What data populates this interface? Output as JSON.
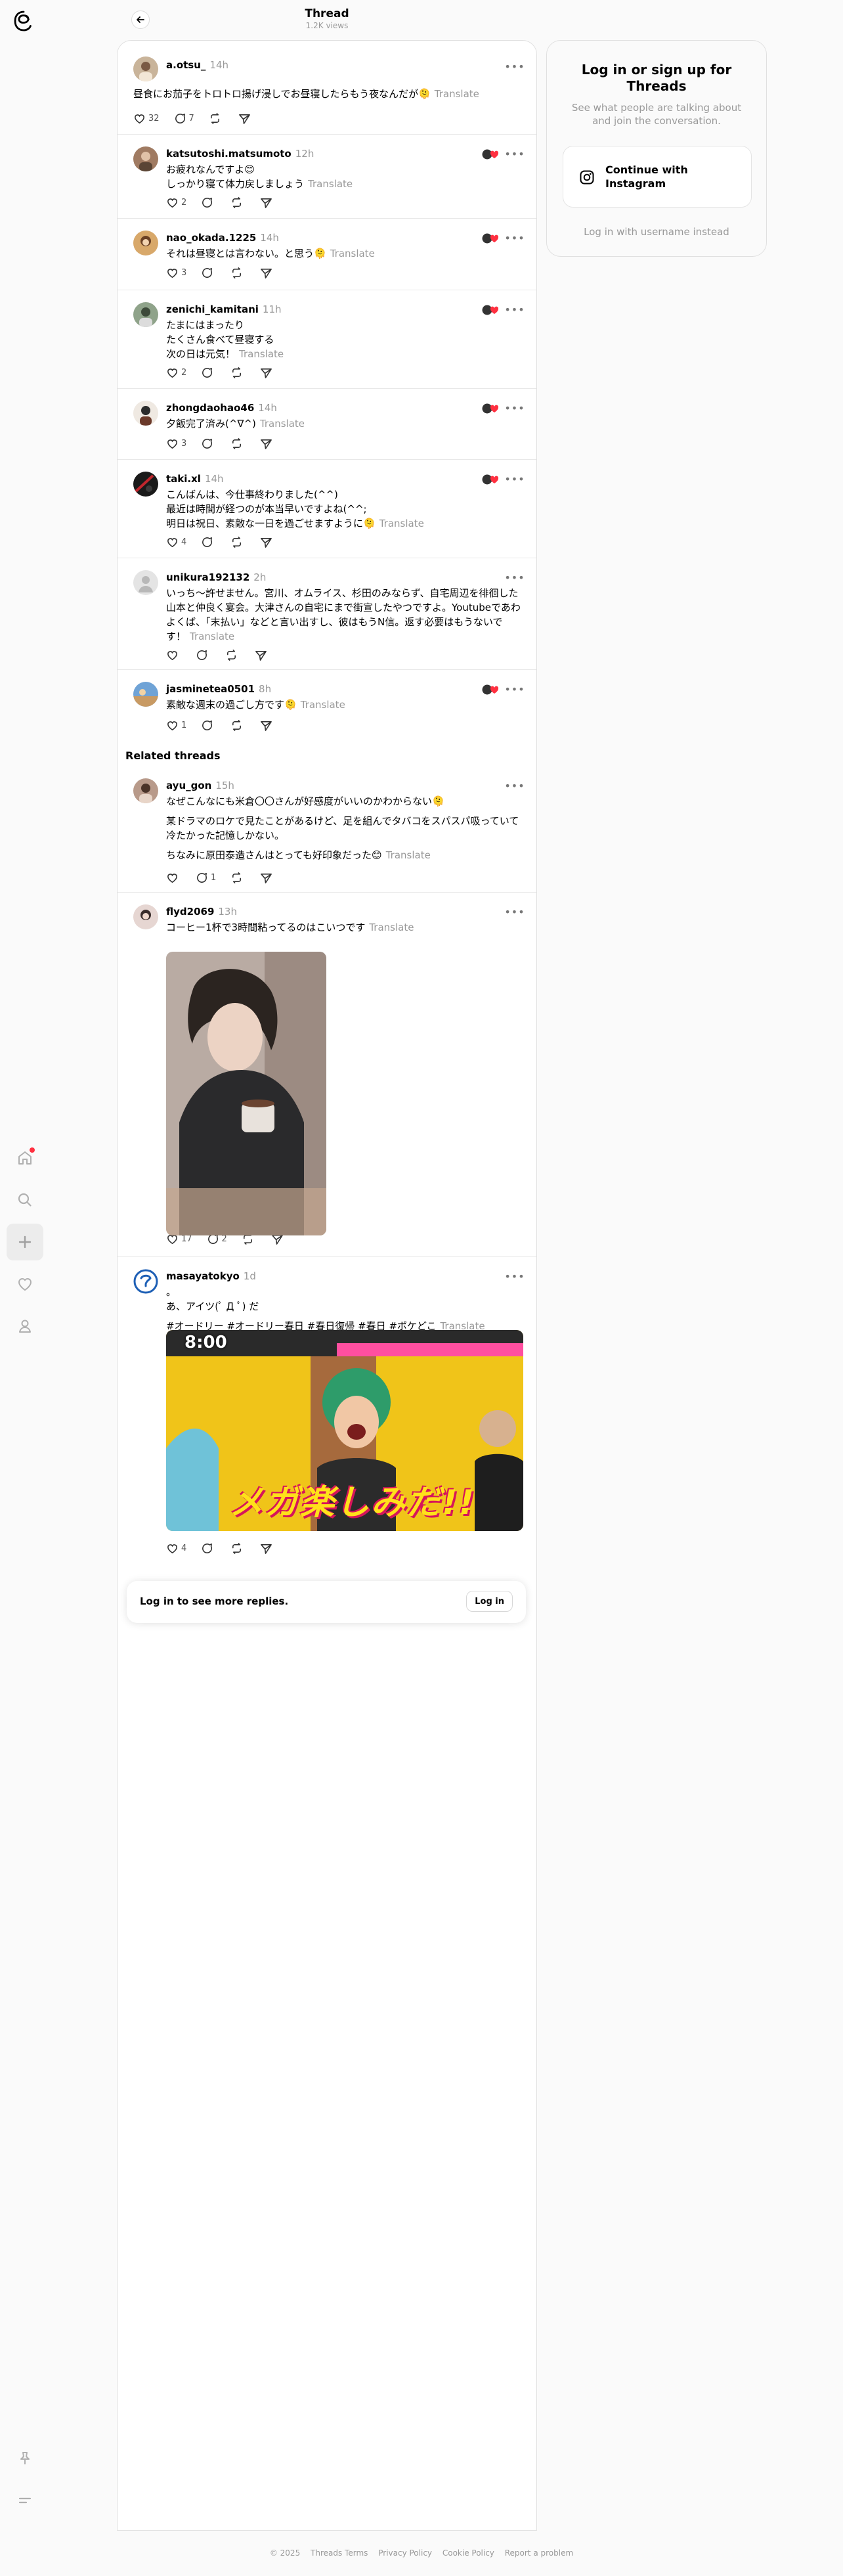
{
  "header": {
    "title": "Thread",
    "views": "1.2K views"
  },
  "posts": [
    {
      "user": "a.otsu_",
      "time": "14h",
      "lines": [
        "昼食にお茄子をトロトロ揚げ浸しでお昼寝したらもう夜なんだが🫠"
      ],
      "translate": "Translate",
      "likes": "32",
      "replies": "7",
      "reposts": "",
      "heart_badge": false
    },
    {
      "user": "katsutoshi.matsumoto",
      "time": "12h",
      "lines": [
        "お疲れなんですよ😊",
        "しっかり寝て体力戻しましょう"
      ],
      "translate": "Translate",
      "likes": "2",
      "replies": "",
      "reposts": "",
      "heart_badge": true
    },
    {
      "user": "nao_okada.1225",
      "time": "14h",
      "lines": [
        "それは昼寝とは言わない。と思う🫠"
      ],
      "translate": "Translate",
      "likes": "3",
      "replies": "",
      "reposts": "",
      "heart_badge": true
    },
    {
      "user": "zenichi_kamitani",
      "time": "11h",
      "lines": [
        "たまにはまったり",
        "たくさん食べて昼寝する",
        "次の日は元気！"
      ],
      "translate": "Translate",
      "likes": "2",
      "replies": "",
      "reposts": "",
      "heart_badge": true
    },
    {
      "user": "zhongdaohao46",
      "time": "14h",
      "lines": [
        "夕飯完了済み(^∇^)"
      ],
      "translate": "Translate",
      "likes": "3",
      "replies": "",
      "reposts": "",
      "heart_badge": true
    },
    {
      "user": "taki.xl",
      "time": "14h",
      "lines": [
        "こんばんは、今仕事終わりました(^^)",
        "最近は時間が経つのが本当早いですよね(^^;",
        "明日は祝日、素敵な一日を過ごせますように🫠"
      ],
      "translate": "Translate",
      "likes": "4",
      "replies": "",
      "reposts": "",
      "heart_badge": true
    },
    {
      "user": "unikura192132",
      "time": "2h",
      "lines": [
        "いっち〜許せません。宮川、オムライス、杉田のみならず、自宅周辺を徘徊した山本と仲良く宴会。大津さんの自宅にまで街宣したやつですよ。Youtubeであわよくば、「末払い」などと言い出すし、彼はもうN信。返す必要はもうないです！"
      ],
      "translate": "Translate",
      "likes": "",
      "replies": "",
      "reposts": "",
      "heart_badge": false
    },
    {
      "user": "jasminetea0501",
      "time": "8h",
      "lines": [
        "素敵な週末の過ごし方です🫠"
      ],
      "translate": "Translate",
      "likes": "1",
      "replies": "",
      "reposts": "",
      "heart_badge": true
    }
  ],
  "related": {
    "title": "Related threads",
    "posts": [
      {
        "user": "ayu_gon",
        "time": "15h",
        "lines": [
          "なぜこんなにも米倉〇〇さんが好感度がいいのかわからない🫠",
          "某ドラマのロケで見たことがあるけど、足を組んでタバコをスパスパ吸っていて冷たかった記憶しかない。",
          "ちなみに原田泰造さんはとっても好印象だった😊"
        ],
        "translate": "Translate",
        "likes": "",
        "replies": "1",
        "reposts": ""
      },
      {
        "user": "flyd2069",
        "time": "13h",
        "lines": [
          "コーヒー1杯で3時間粘ってるのはこいつです"
        ],
        "translate": "Translate",
        "likes": "17",
        "replies": "2",
        "reposts": ""
      },
      {
        "user": "masayatokyo",
        "time": "1d",
        "lines": [
          "。",
          "あ、アイツ(ﾟ Д ﾟ) だ",
          "#オードリー #オードリー春日 #春日復帰 #春日 #ポケどこ"
        ],
        "translate": "Translate",
        "likes": "4",
        "replies": "",
        "reposts": "",
        "media_caption": "メガ楽しみだ!!",
        "media_time": "8:00"
      }
    ]
  },
  "login_bar": {
    "text": "Log in to see more replies.",
    "button": "Log in"
  },
  "login_card": {
    "title": "Log in or sign up for Threads",
    "subtitle": "See what people are talking about and join the conversation.",
    "instagram_button": "Continue with Instagram",
    "alt_link": "Log in with username instead"
  },
  "footer": [
    "© 2025",
    "Threads Terms",
    "Privacy Policy",
    "Cookie Policy",
    "Report a problem"
  ],
  "colors": {
    "accent_red": "#ff3040",
    "muted": "#999999",
    "border": "#e0e0e0"
  }
}
